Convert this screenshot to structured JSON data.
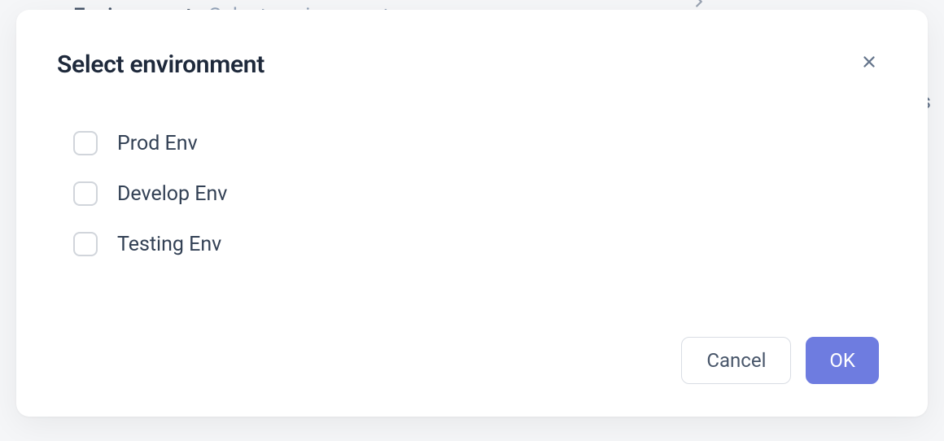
{
  "background": {
    "field_label": "Environment",
    "field_placeholder": "Select environment",
    "side_letter": "s"
  },
  "modal": {
    "title": "Select environment",
    "options": [
      {
        "label": "Prod Env"
      },
      {
        "label": "Develop Env"
      },
      {
        "label": "Testing Env"
      }
    ],
    "buttons": {
      "cancel": "Cancel",
      "ok": "OK"
    }
  }
}
